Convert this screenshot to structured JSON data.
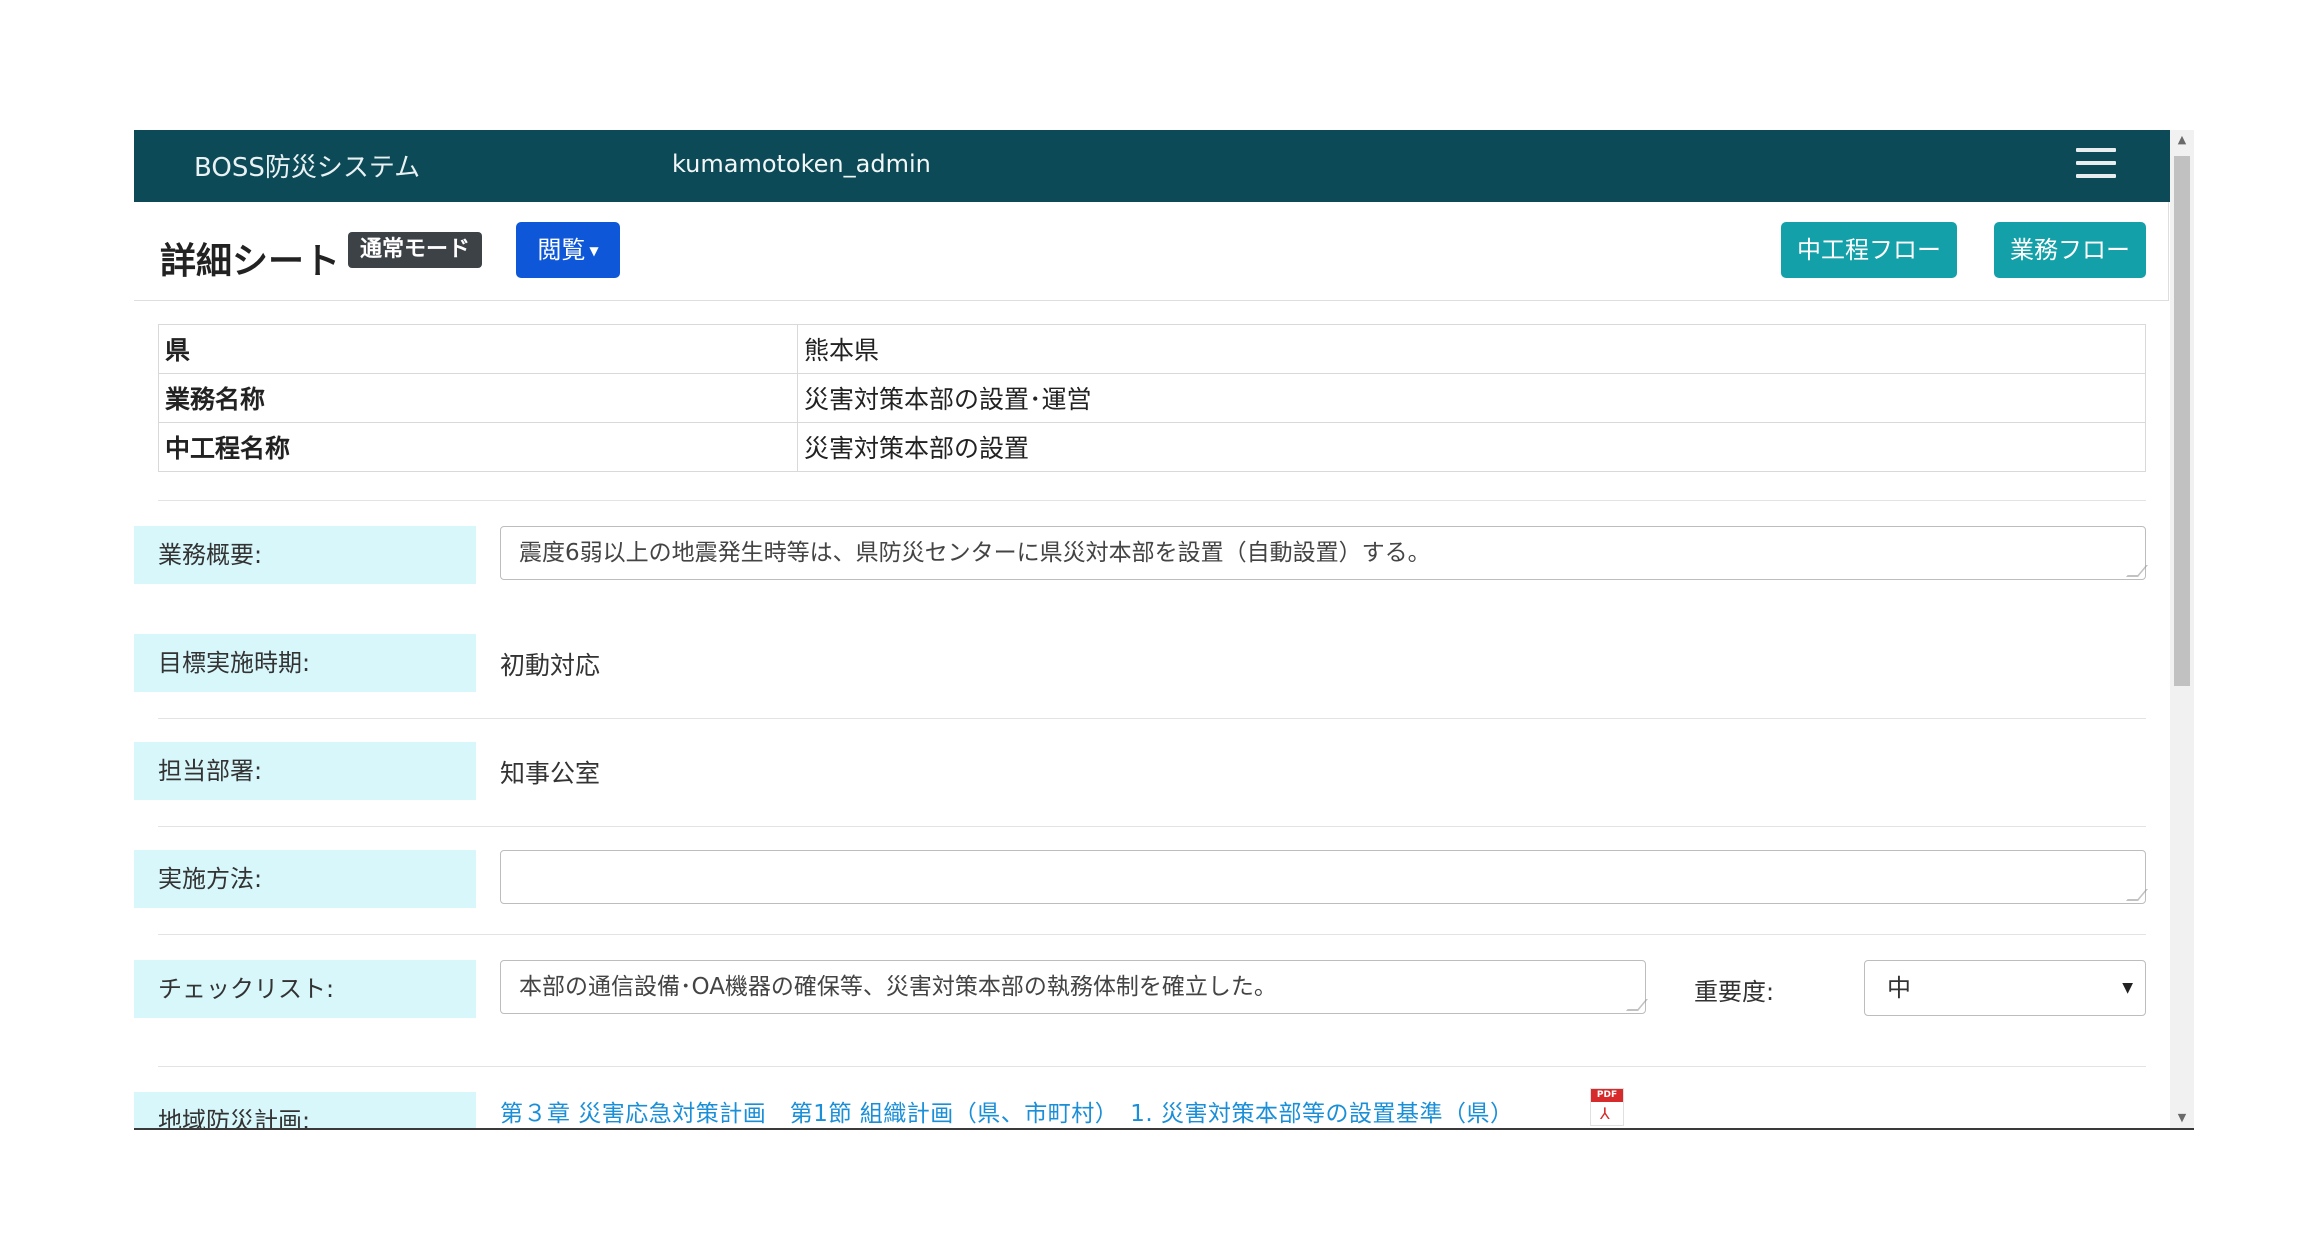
{
  "navbar": {
    "brand": "BOSS防災システム",
    "user": "kumamotoken_admin"
  },
  "header": {
    "title": "詳細シート",
    "mode_badge": "通常モード",
    "view_button": "閲覧",
    "chukotei_flow_button": "中工程フロー",
    "gyomu_flow_button": "業務フロー"
  },
  "info_table": {
    "rows": [
      {
        "label": "県",
        "value": "熊本県"
      },
      {
        "label": "業務名称",
        "value": "災害対策本部の設置･運営"
      },
      {
        "label": "中工程名称",
        "value": "災害対策本部の設置"
      }
    ]
  },
  "fields": {
    "summary_label": "業務概要:",
    "summary_value": "震度6弱以上の地震発生時等は、県防災センターに県災対本部を設置（自動設置）する。",
    "target_period_label": "目標実施時期:",
    "target_period_value": "初動対応",
    "department_label": "担当部署:",
    "department_value": "知事公室",
    "method_label": "実施方法:",
    "method_value": "",
    "checklist_label": "チェックリスト:",
    "checklist_value": "本部の通信設備･OA機器の確保等、災害対策本部の執務体制を確立した。",
    "importance_label": "重要度:",
    "importance_value": "中",
    "regional_plan_label": "地域防災計画:",
    "regional_plan_link": "第３章 災害応急対策計画　第1節 組織計画（県、市町村）　1. 災害対策本部等の設置基準（県）"
  },
  "icons": {
    "menu": "hamburger-menu-icon",
    "pdf": "pdf-file-icon"
  },
  "colors": {
    "navbar": "#0b4a56",
    "view_button": "#0d57d8",
    "flow_buttons": "#14a0a8",
    "field_label_bg": "#d8f7fb",
    "link": "#1a8fd8"
  }
}
